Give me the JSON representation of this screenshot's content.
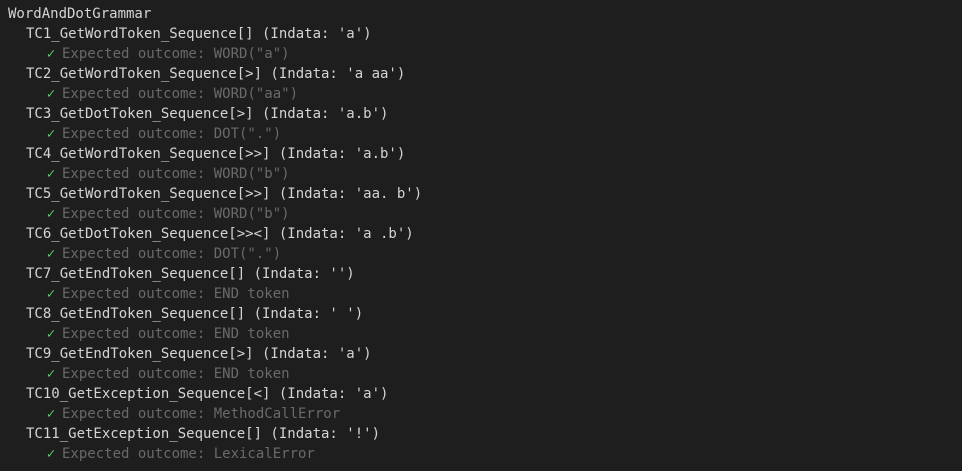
{
  "suite": "WordAndDotGrammar",
  "colors": {
    "background": "#1e1e1e",
    "text": "#d4d4d4",
    "muted": "#6a6a6a",
    "pass": "#4ec96b"
  },
  "icons": {
    "pass": "check-icon"
  },
  "tests": [
    {
      "name": "TC1_GetWordToken_Sequence[] (Indata: 'a')",
      "result": "Expected outcome: WORD(\"a\")"
    },
    {
      "name": "TC2_GetWordToken_Sequence[>] (Indata: 'a aa')",
      "result": "Expected outcome: WORD(\"aa\")"
    },
    {
      "name": "TC3_GetDotToken_Sequence[>] (Indata: 'a.b')",
      "result": "Expected outcome: DOT(\".\")"
    },
    {
      "name": "TC4_GetWordToken_Sequence[>>] (Indata: 'a.b')",
      "result": "Expected outcome: WORD(\"b\")"
    },
    {
      "name": "TC5_GetWordToken_Sequence[>>] (Indata: 'aa. b')",
      "result": "Expected outcome: WORD(\"b\")"
    },
    {
      "name": "TC6_GetDotToken_Sequence[>><] (Indata: 'a .b')",
      "result": "Expected outcome: DOT(\".\")"
    },
    {
      "name": "TC7_GetEndToken_Sequence[] (Indata: '')",
      "result": "Expected outcome: END token"
    },
    {
      "name": "TC8_GetEndToken_Sequence[] (Indata: ' ')",
      "result": "Expected outcome: END token"
    },
    {
      "name": "TC9_GetEndToken_Sequence[>] (Indata: 'a')",
      "result": "Expected outcome: END token"
    },
    {
      "name": "TC10_GetException_Sequence[<] (Indata: 'a')",
      "result": "Expected outcome: MethodCallError"
    },
    {
      "name": "TC11_GetException_Sequence[] (Indata: '!')",
      "result": "Expected outcome: LexicalError"
    }
  ]
}
